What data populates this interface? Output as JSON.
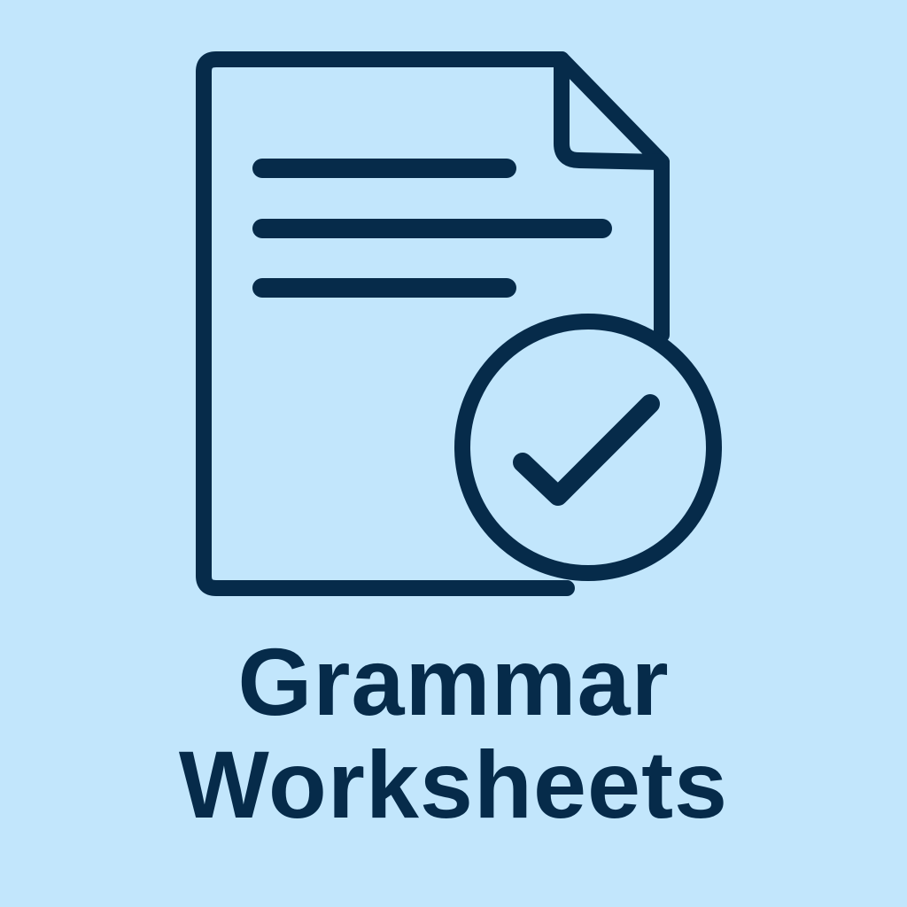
{
  "background_color": "#c2e6fc",
  "ink_color": "#062b4a",
  "icon": {
    "name": "worksheet-document-icon",
    "badge": "checkmark-badge-icon"
  },
  "caption": {
    "line1": "Grammar",
    "line2": "Worksheets"
  }
}
